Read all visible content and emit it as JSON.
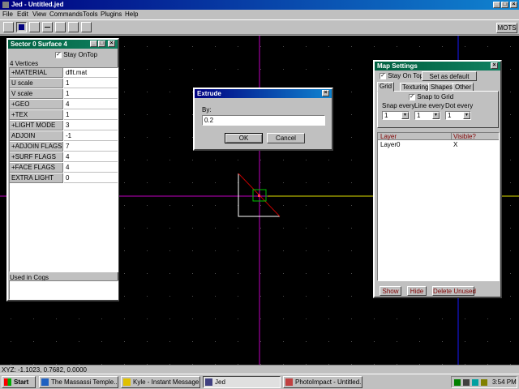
{
  "app": {
    "title": "Jed - Untitled.jed"
  },
  "menu": [
    "File",
    "Edit",
    "View",
    "Commands",
    "Tools",
    "Plugins",
    "Help"
  ],
  "toolbar": {
    "mode_label": "MOTS"
  },
  "sector_panel": {
    "title": "Sector 0 Surface 4",
    "stay_on_top": "Stay OnTop",
    "vertices_label": "4 Vertices",
    "rows": [
      {
        "k": "+MATERIAL",
        "v": "dflt.mat"
      },
      {
        "k": "U scale",
        "v": "1"
      },
      {
        "k": "V scale",
        "v": "1"
      },
      {
        "k": "+GEO",
        "v": "4"
      },
      {
        "k": "+TEX",
        "v": "1"
      },
      {
        "k": "+LIGHT MODE",
        "v": "3"
      },
      {
        "k": "ADJOIN",
        "v": "-1"
      },
      {
        "k": "+ADJOIN FLAGS",
        "v": "7"
      },
      {
        "k": "+SURF FLAGS",
        "v": "4"
      },
      {
        "k": "+FACE FLAGS",
        "v": "4"
      },
      {
        "k": "EXTRA LIGHT",
        "v": "0"
      }
    ],
    "used_in_cogs": "Used in Cogs"
  },
  "extrude_dialog": {
    "title": "Extrude",
    "by_label": "By:",
    "value": "0.2",
    "ok": "OK",
    "cancel": "Cancel"
  },
  "map_settings": {
    "title": "Map Settings",
    "stay_on_top": "Stay On Top",
    "set_default": "Set as default",
    "tabs": [
      "Grid",
      "Texturing",
      "Shapes",
      "Other"
    ],
    "snap_to_grid": "Snap to Grid",
    "snap_every_label": "Snap every",
    "snap_every": "1",
    "line_every_label": "Line every",
    "line_every": "1",
    "dot_every_label": "Dot every",
    "dot_every": "1",
    "layer_col": "Layer",
    "visible_col": "Visible?",
    "layers": [
      {
        "name": "Layer0",
        "visible": "X"
      }
    ],
    "show": "Show",
    "hide": "Hide",
    "delete_unused": "Delete Unused"
  },
  "status": {
    "coords": "XYZ: -1.1023, 0.7682, 0.0000"
  },
  "taskbar": {
    "start": "Start",
    "items": [
      "The Massassi Temple...",
      "Kyle - Instant Message",
      "Jed",
      "PhotoImpact - Untitled..."
    ],
    "clock": "3:54 PM"
  },
  "colors": {
    "title_blue": "#000080",
    "panel_green": "#006040",
    "canvas": "#000000",
    "axis": "#c000c0",
    "grid_line": "#1818ff",
    "yellow_axis": "#e0e000"
  }
}
